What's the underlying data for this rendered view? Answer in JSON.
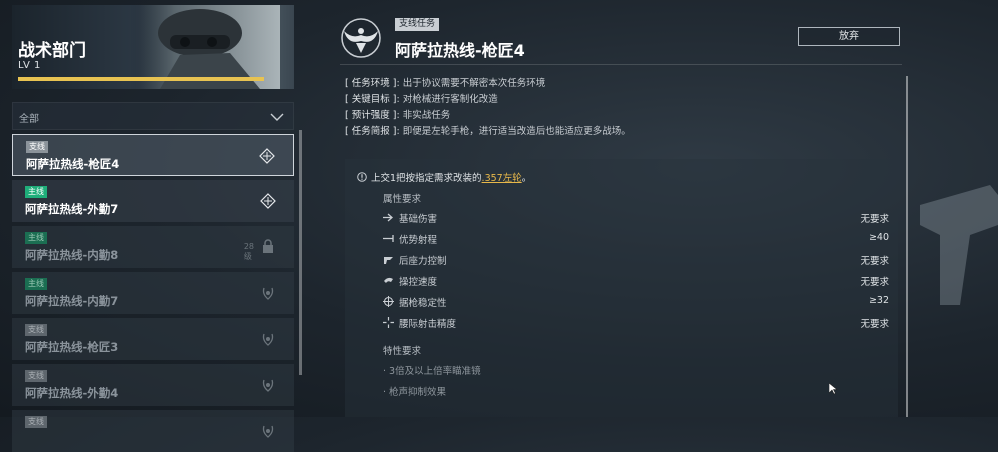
{
  "left": {
    "banner": {
      "title": "战术部门",
      "level": "LV 1"
    },
    "filter": {
      "label": "全部"
    },
    "quests": [
      {
        "tag": "支线",
        "tag_type": "side",
        "name": "阿萨拉热线-枪匠4",
        "state": "active",
        "icon": "target-diamond-icon"
      },
      {
        "tag": "主线",
        "tag_type": "main",
        "name": "阿萨拉热线-外勤7",
        "state": "available",
        "icon": "target-diamond-icon"
      },
      {
        "tag": "主线",
        "tag_type": "main",
        "name": "阿萨拉热线-内勤8",
        "state": "locked",
        "level_req": "28级",
        "icon": "lock-icon"
      },
      {
        "tag": "主线",
        "tag_type": "main",
        "name": "阿萨拉热线-内勤7",
        "state": "done",
        "icon": "laurel-icon"
      },
      {
        "tag": "支线",
        "tag_type": "side",
        "name": "阿萨拉热线-枪匠3",
        "state": "done",
        "icon": "laurel-icon"
      },
      {
        "tag": "支线",
        "tag_type": "side",
        "name": "阿萨拉热线-外勤4",
        "state": "done",
        "icon": "laurel-icon"
      },
      {
        "tag": "支线",
        "tag_type": "side",
        "name": "",
        "state": "done",
        "icon": "laurel-icon"
      }
    ]
  },
  "mission": {
    "tag": "支线任务",
    "title": "阿萨拉热线-枪匠4",
    "abandon_label": "放弃",
    "info": [
      {
        "key": "[ 任务环境 ]",
        "value": "出于协议需要不解密本次任务环境"
      },
      {
        "key": "[ 关键目标 ]",
        "value": "对枪械进行客制化改造"
      },
      {
        "key": "[ 预计强度 ]",
        "value": "非实战任务"
      },
      {
        "key": "[ 任务简报 ]",
        "value": "即便是左轮手枪，进行适当改造后也能适应更多战场。"
      }
    ],
    "requirement": {
      "text_before": "上交1把按指定需求改装的",
      "highlight": ".357左轮",
      "text_after": "。",
      "attr_title": "属性要求",
      "attributes": [
        {
          "icon": "damage-icon",
          "name": "基础伤害",
          "value": "无要求"
        },
        {
          "icon": "range-icon",
          "name": "优势射程",
          "value": "≥40"
        },
        {
          "icon": "recoil-icon",
          "name": "后座力控制",
          "value": "无要求"
        },
        {
          "icon": "handling-icon",
          "name": "操控速度",
          "value": "无要求"
        },
        {
          "icon": "crosshair-icon",
          "name": "据枪稳定性",
          "value": "≥32"
        },
        {
          "icon": "hipfire-icon",
          "name": "腰际射击精度",
          "value": "无要求"
        }
      ],
      "trait_title": "特性要求",
      "traits": [
        "· 3倍及以上倍率瞄准镜",
        "· 枪声抑制效果"
      ]
    }
  },
  "colors": {
    "accent_gold": "#e8c352",
    "main_green": "#1fae7a",
    "side_gray": "#8b939a",
    "highlight": "#e8b84a"
  }
}
